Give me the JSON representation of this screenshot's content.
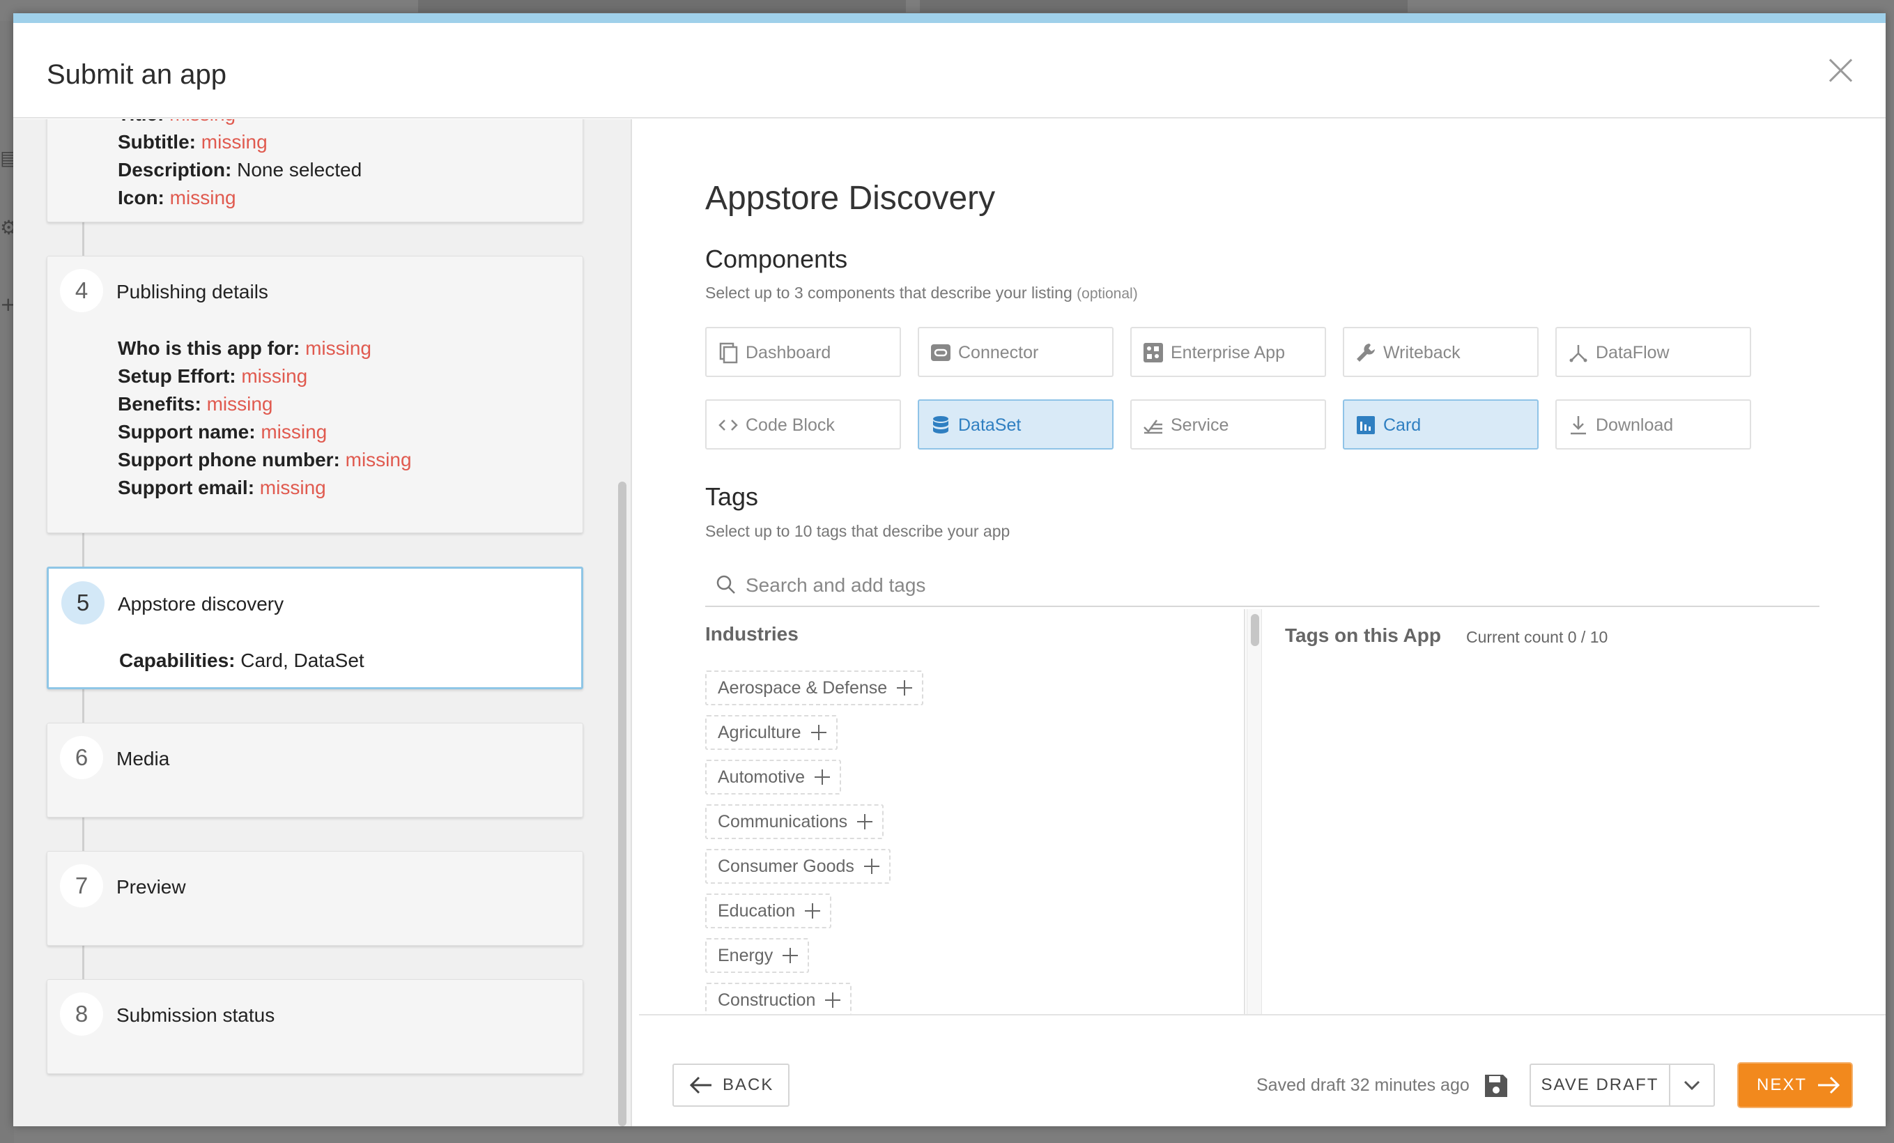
{
  "modal": {
    "title": "Submit an app"
  },
  "steps": {
    "step3": {
      "lines": [
        {
          "key": "Title:",
          "value": "missing",
          "status": "missing"
        },
        {
          "key": "Subtitle:",
          "value": "missing",
          "status": "missing"
        },
        {
          "key": "Description:",
          "value": "None selected",
          "status": "ok"
        },
        {
          "key": "Icon:",
          "value": "missing",
          "status": "missing"
        }
      ]
    },
    "step4": {
      "number": "4",
      "title": "Publishing details",
      "lines": [
        {
          "key": "Who is this app for:",
          "value": "missing"
        },
        {
          "key": "Setup Effort:",
          "value": "missing"
        },
        {
          "key": "Benefits:",
          "value": "missing"
        },
        {
          "key": "Support name:",
          "value": "missing"
        },
        {
          "key": "Support phone number:",
          "value": "missing"
        },
        {
          "key": "Support email:",
          "value": "missing"
        }
      ]
    },
    "step5": {
      "number": "5",
      "title": "Appstore discovery",
      "capabilities_key": "Capabilities:",
      "capabilities_value": "Card, DataSet"
    },
    "step6": {
      "number": "6",
      "title": "Media"
    },
    "step7": {
      "number": "7",
      "title": "Preview"
    },
    "step8": {
      "number": "8",
      "title": "Submission status"
    }
  },
  "content": {
    "heading": "Appstore Discovery",
    "components": {
      "title": "Components",
      "subtitle": "Select up to 3 components that describe your listing",
      "subtitle_optional": "(optional)",
      "items": [
        {
          "label": "Dashboard",
          "icon": "dashboard-icon",
          "selected": false
        },
        {
          "label": "Connector",
          "icon": "connector-icon",
          "selected": false
        },
        {
          "label": "Enterprise App",
          "icon": "enterprise-app-icon",
          "selected": false
        },
        {
          "label": "Writeback",
          "icon": "wrench-icon",
          "selected": false
        },
        {
          "label": "DataFlow",
          "icon": "dataflow-icon",
          "selected": false
        },
        {
          "label": "Code Block",
          "icon": "code-icon",
          "selected": false
        },
        {
          "label": "DataSet",
          "icon": "database-icon",
          "selected": true
        },
        {
          "label": "Service",
          "icon": "service-icon",
          "selected": false
        },
        {
          "label": "Card",
          "icon": "bar-chart-icon",
          "selected": true
        },
        {
          "label": "Download",
          "icon": "download-icon",
          "selected": false
        }
      ]
    },
    "tags": {
      "title": "Tags",
      "subtitle": "Select up to 10 tags that describe your app",
      "search_placeholder": "Search and add tags",
      "industries_title": "Industries",
      "industries": [
        "Aerospace & Defense",
        "Agriculture",
        "Automotive",
        "Communications",
        "Consumer Goods",
        "Education",
        "Energy",
        "Construction"
      ],
      "on_app_title": "Tags on this App",
      "current_count": "Current count 0 / 10"
    }
  },
  "footer": {
    "back_label": "BACK",
    "saved_text": "Saved draft 32 minutes ago",
    "save_draft_label": "SAVE DRAFT",
    "next_label": "NEXT"
  },
  "colors": {
    "accent_blue": "#8fc6e6",
    "selected_bg": "#d9eaf7",
    "missing_red": "#e05a4f",
    "next_orange": "#f2891d"
  }
}
